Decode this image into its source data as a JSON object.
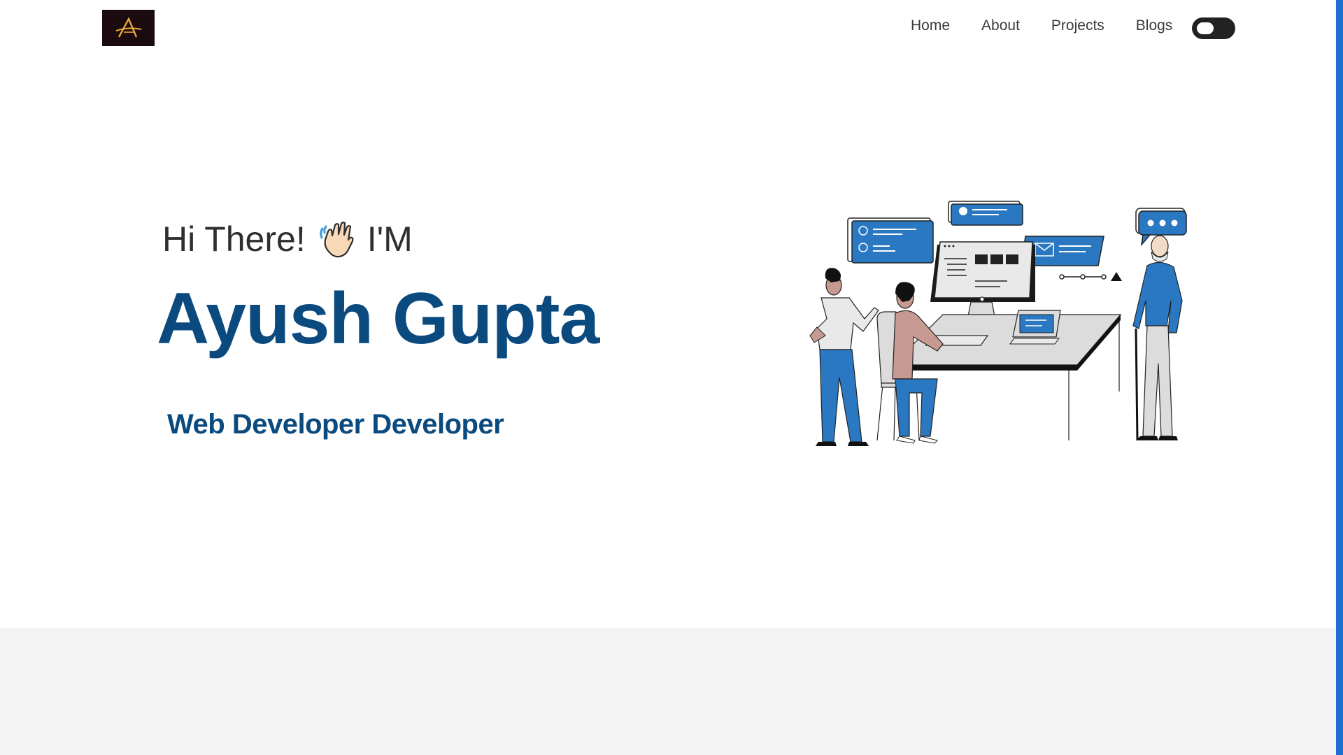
{
  "logo": {
    "glyph": "A",
    "alt": "logo"
  },
  "nav": {
    "items": [
      {
        "label": "Home"
      },
      {
        "label": "About"
      },
      {
        "label": "Projects"
      },
      {
        "label": "Blogs"
      }
    ]
  },
  "theme_toggle": {
    "state": "off"
  },
  "hero": {
    "greeting": "Hi There!",
    "wave_icon": "waving-hand-icon",
    "greeting_suffix": "I'M",
    "name": "Ayush Gupta",
    "role": "Web Developer Developer"
  },
  "colors": {
    "name_blue": "#0a4a7f",
    "accent_blue": "#2a78c2",
    "logo_bg": "#1c0b0e",
    "logo_gold": "#e3a83a",
    "toggle_bg": "#222222",
    "section_bg": "#f5f4f5",
    "edge_bar": "#1f6fd0"
  }
}
